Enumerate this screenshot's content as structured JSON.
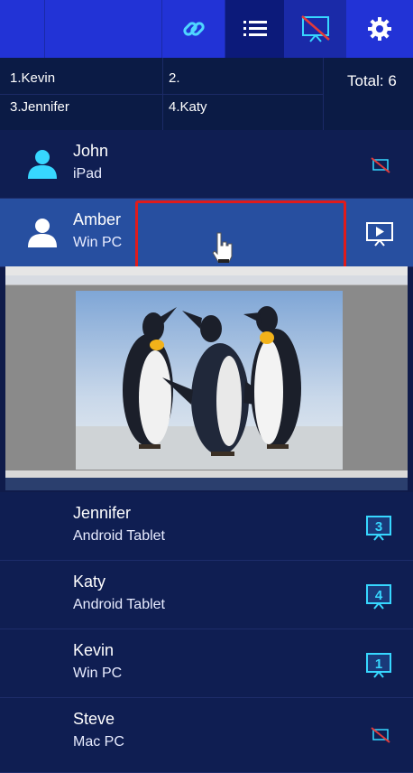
{
  "toolbar": {
    "icons": [
      "link-icon",
      "list-icon",
      "screen-off-icon",
      "gear-icon"
    ],
    "colors": {
      "bar": "#2233d6",
      "active": "#0c1a7a"
    }
  },
  "queue": {
    "slot1": "1.Kevin",
    "slot2": "2.",
    "slot3": "3.Jennifer",
    "slot4": "4.Katy",
    "total": "Total: 6"
  },
  "users": [
    {
      "name": "John",
      "device": "iPad",
      "status_icon": "screen-off-icon"
    },
    {
      "name": "Amber",
      "device": "Win PC",
      "status_icon": "present-icon",
      "selected": true
    },
    {
      "name": "Jennifer",
      "device": "Android Tablet",
      "status_icon": "queue-3-icon",
      "queue_number": "3"
    },
    {
      "name": "Katy",
      "device": "Android Tablet",
      "status_icon": "queue-4-icon",
      "queue_number": "4"
    },
    {
      "name": "Kevin",
      "device": "Win PC",
      "status_icon": "queue-1-icon",
      "queue_number": "1"
    },
    {
      "name": "Steve",
      "device": "Mac PC",
      "status_icon": "screen-off-icon"
    }
  ],
  "preview": {
    "subject": "penguins-image"
  },
  "colors": {
    "background": "#0f1b4a",
    "selected_row": "#274fa0",
    "highlight_box": "#e01b1b",
    "icon_cyan": "#37d7ff"
  }
}
